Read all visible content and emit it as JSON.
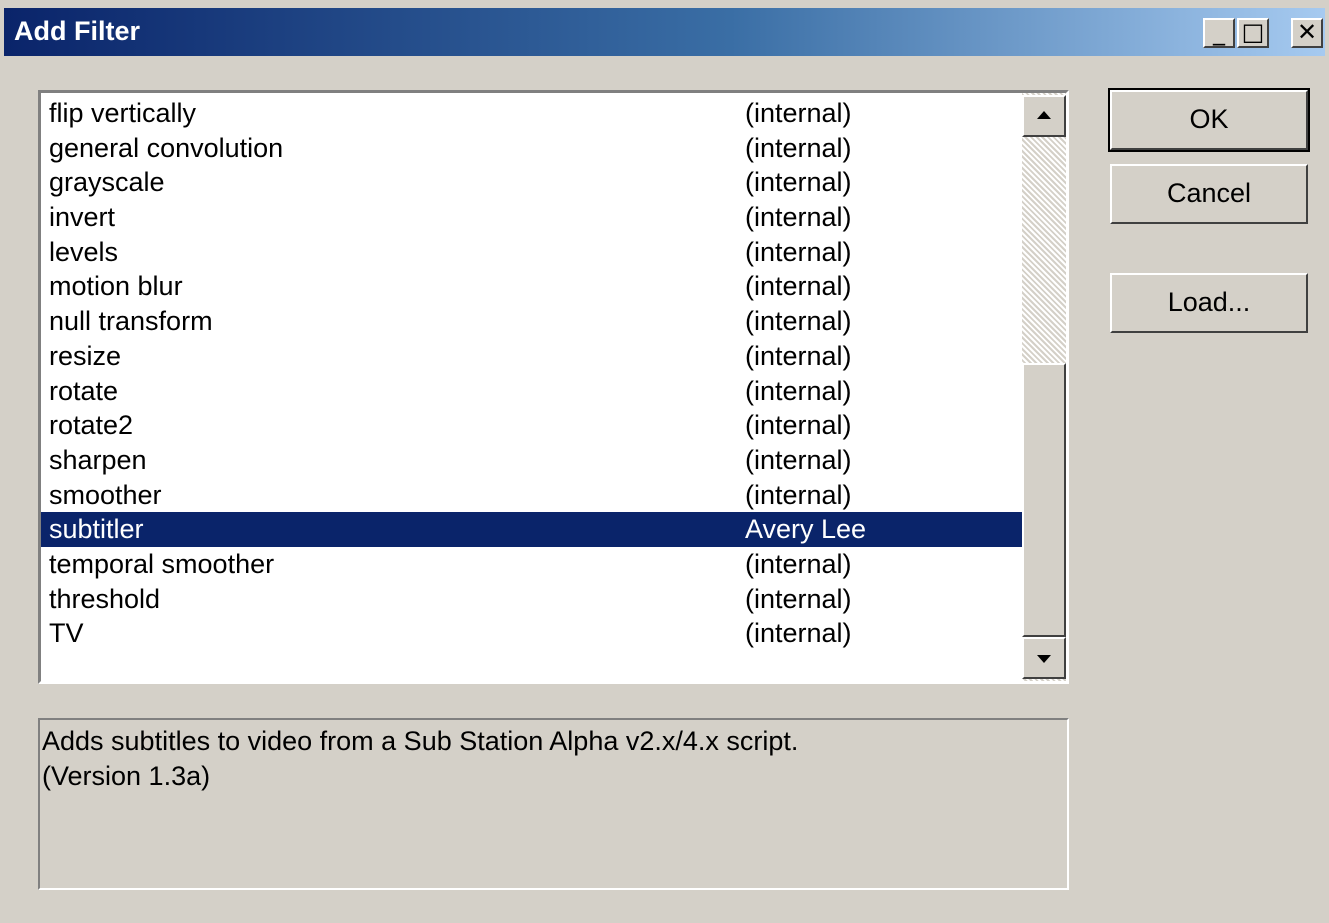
{
  "window": {
    "title": "Add Filter",
    "minimize_label": "_",
    "maximize_label": "□",
    "close_label": "✕"
  },
  "filters": [
    {
      "name": "flip vertically",
      "source": "(internal)"
    },
    {
      "name": "general convolution",
      "source": "(internal)"
    },
    {
      "name": "grayscale",
      "source": "(internal)"
    },
    {
      "name": "invert",
      "source": "(internal)"
    },
    {
      "name": "levels",
      "source": "(internal)"
    },
    {
      "name": "motion blur",
      "source": "(internal)"
    },
    {
      "name": "null transform",
      "source": "(internal)"
    },
    {
      "name": "resize",
      "source": "(internal)"
    },
    {
      "name": "rotate",
      "source": "(internal)"
    },
    {
      "name": "rotate2",
      "source": "(internal)"
    },
    {
      "name": "sharpen",
      "source": "(internal)"
    },
    {
      "name": "smoother",
      "source": "(internal)"
    },
    {
      "name": "subtitler",
      "source": "Avery Lee",
      "selected": true
    },
    {
      "name": "temporal smoother",
      "source": "(internal)"
    },
    {
      "name": "threshold",
      "source": "(internal)"
    },
    {
      "name": "TV",
      "source": "(internal)"
    }
  ],
  "buttons": {
    "ok": "OK",
    "cancel": "Cancel",
    "load": "Load..."
  },
  "description": {
    "line1": "Adds subtitles to video from a Sub Station Alpha v2.x/4.x script.",
    "line2": "(Version 1.3a)"
  },
  "colors": {
    "dialog_bg": "#d4d0c8",
    "selection_bg": "#0a246a",
    "selection_fg": "#ffffff"
  }
}
